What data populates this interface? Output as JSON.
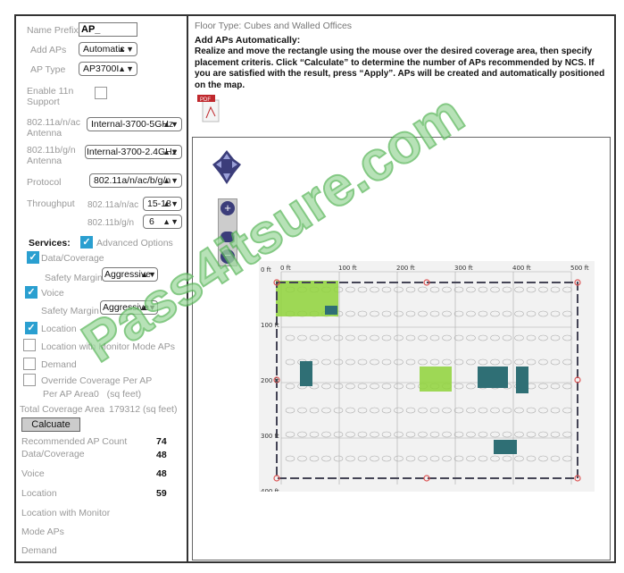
{
  "left": {
    "name_prefix_label": "Name Prefix",
    "name_prefix_value": "AP_",
    "add_aps_label": "Add APs",
    "add_aps_value": "Automatic",
    "ap_type_label": "AP Type",
    "ap_type_value": "AP3700I",
    "enable_11n_label": "Enable 11n Support",
    "enable_11n_checked": false,
    "antenna_a_label": "802.11a/n/ac Antenna",
    "antenna_a_value": "Internal-3700-5GHz",
    "antenna_b_label": "802.11b/g/n Antenna",
    "antenna_b_value": "Internal-3700-2.4GHz",
    "protocol_label": "Protocol",
    "protocol_value": "802.11a/n/ac/b/g/n",
    "throughput_label": "Throughput",
    "throughput_a_label": "802.11a/n/ac",
    "throughput_a_value": "15-18",
    "throughput_b_label": "802.11b/g/n",
    "throughput_b_value": "6",
    "services_label": "Services:",
    "advanced_options_label": "Advanced Options",
    "data_coverage_label": "Data/Coverage",
    "safety_margin_label": "Safety Margin",
    "safety_margin_data_value": "Aggressive",
    "voice_label": "Voice",
    "safety_margin_voice_value": "Aggressive",
    "location_label": "Location",
    "location_monitor_label": "Location with Monitor Mode APs",
    "demand_label": "Demand",
    "override_label": "Override Coverage Per AP",
    "per_ap_area_label": "Per AP Area0   (sq feet)",
    "total_coverage_label": "Total Coverage Area",
    "total_coverage_value": "179312 (sq feet)",
    "calculate_label": "Calcuate",
    "results": {
      "recommended_label": "Recommended AP Count",
      "recommended_value": "74",
      "data_label": "Data/Coverage",
      "data_value": "48",
      "voice_label": "Voice",
      "voice_value": "48",
      "location_label": "Location",
      "location_value": "59",
      "location_monitor_label_1": "Location with Monitor",
      "location_monitor_label_2": "Mode APs",
      "demand_label": "Demand"
    }
  },
  "right": {
    "floor_type": "Floor Type: Cubes and Walled Offices",
    "heading": "Add APs Automatically:",
    "instructions": "Realize and move the rectangle using the mouse over the desired coverage area, then specify placement criteris. Click “Calculate” to determine the number of APs recommended by NCS. If you are satisfied with the result, press “Apply”. APs will be created and automatically positioned on the map.",
    "pdf_icon_label": "PDF",
    "map": {
      "x_ticks": [
        "0 ft",
        "100 ft",
        "200 ft",
        "300 ft",
        "400 ft",
        "500 ft"
      ],
      "y_ticks": [
        "0 ft",
        "100 ft",
        "200 ft",
        "300 ft",
        "400 ft"
      ]
    }
  },
  "watermark": "Pass4itsure.com",
  "colors": {
    "checkbox": "#2a9fd0",
    "nav_control": "#3b3d7a",
    "coverage_green": "#8fd43a",
    "ap_teal": "#2f6f75"
  }
}
